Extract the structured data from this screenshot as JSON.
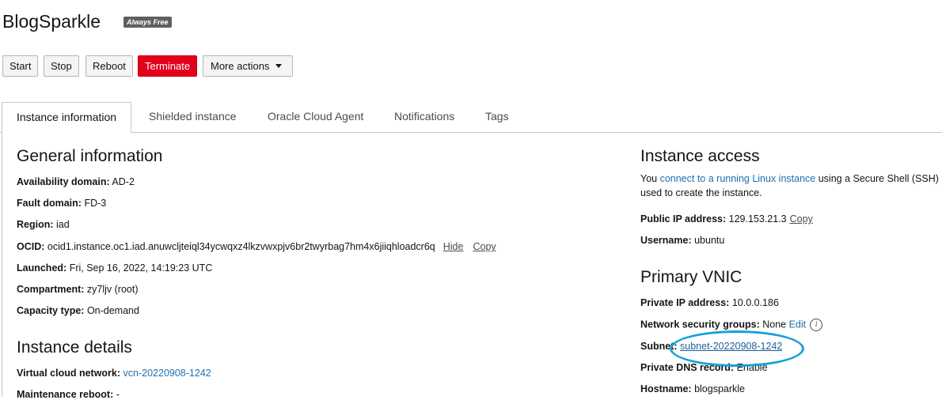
{
  "header": {
    "title": "BlogSparkle",
    "badge": "Always Free"
  },
  "actions": {
    "start": "Start",
    "stop": "Stop",
    "reboot": "Reboot",
    "terminate": "Terminate",
    "more": "More actions"
  },
  "tabs": [
    {
      "label": "Instance information"
    },
    {
      "label": "Shielded instance"
    },
    {
      "label": "Oracle Cloud Agent"
    },
    {
      "label": "Notifications"
    },
    {
      "label": "Tags"
    }
  ],
  "general": {
    "heading": "General information",
    "availability_label": "Availability domain:",
    "availability_value": "AD-2",
    "fault_label": "Fault domain:",
    "fault_value": "FD-3",
    "region_label": "Region:",
    "region_value": "iad",
    "ocid_label": "OCID:",
    "ocid_value": "ocid1.instance.oc1.iad.anuwcljteiql34ycwqxz4lkzvwxpjv6br2twyrbag7hm4x6jiiqhloadcr6q",
    "hide": "Hide",
    "copy": "Copy",
    "launched_label": "Launched:",
    "launched_value": "Fri, Sep 16, 2022, 14:19:23 UTC",
    "compartment_label": "Compartment:",
    "compartment_value": "zy7ljv (root)",
    "capacity_label": "Capacity type:",
    "capacity_value": "On-demand"
  },
  "details": {
    "heading": "Instance details",
    "vcn_label": "Virtual cloud network:",
    "vcn_value": "vcn-20220908-1242",
    "maint_label": "Maintenance reboot:",
    "maint_value": "-"
  },
  "access": {
    "heading": "Instance access",
    "desc_prefix": "You ",
    "desc_link": "connect to a running Linux instance",
    "desc_suffix": " using a Secure Shell (SSH)",
    "desc_line2": "used to create the instance.",
    "public_ip_label": "Public IP address:",
    "public_ip_value": "129.153.21.3",
    "copy": "Copy",
    "username_label": "Username:",
    "username_value": "ubuntu"
  },
  "vnic": {
    "heading": "Primary VNIC",
    "private_ip_label": "Private IP address:",
    "private_ip_value": "10.0.0.186",
    "nsg_label": "Network security groups:",
    "nsg_value": "None",
    "edit": "Edit",
    "info_icon": "i",
    "subnet_label": "Subnet:",
    "subnet_value": "subnet-20220908-1242",
    "dns_label": "Private DNS record:",
    "dns_value": "Enable",
    "hostname_label": "Hostname:",
    "hostname_value": "blogsparkle"
  },
  "colors": {
    "terminate": "#e2001a",
    "link": "#1f6fae",
    "highlight_ellipse": "#1a9fd9"
  }
}
